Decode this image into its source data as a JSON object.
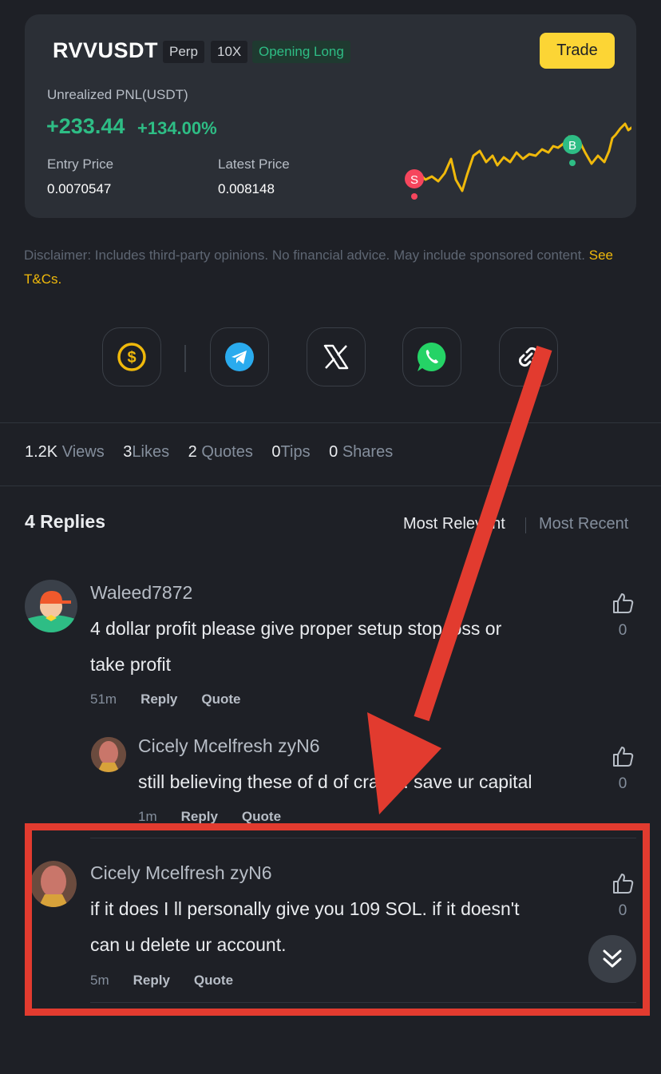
{
  "position": {
    "symbol": "RVVUSDT",
    "tags": [
      "Perp",
      "10X",
      "Opening Long"
    ],
    "trade_label": "Trade",
    "pnl_label": "Unrealized PNL(USDT)",
    "pnl_value": "+233.44",
    "pnl_pct": "+134.00%",
    "entry_label": "Entry Price",
    "entry_value": "0.0070547",
    "latest_label": "Latest Price",
    "latest_value": "0.008148",
    "sell_marker": "S",
    "buy_marker": "B"
  },
  "disclaimer": {
    "text": "Disclaimer: Includes third-party opinions. No financial advice. May include sponsored content.",
    "link": "See T&Cs."
  },
  "share": {
    "icons": [
      "tip-dollar-icon",
      "telegram-icon",
      "x-icon",
      "whatsapp-icon",
      "link-icon"
    ]
  },
  "stats": {
    "views_num": "1.2K",
    "views_label": "Views",
    "likes_num": "3",
    "likes_label": "Likes",
    "quotes_num": "2",
    "quotes_label": "Quotes",
    "tips_num": "0",
    "tips_label": "Tips",
    "shares_num": "0",
    "shares_label": "Shares"
  },
  "replies": {
    "title": "4 Replies",
    "sort_relevant": "Most Relevant",
    "sort_recent": "Most Recent",
    "items": [
      {
        "user": "Waleed7872",
        "line1": "4 dollar profit please give proper setup stop loss or",
        "line2": "take profit",
        "time": "51m",
        "reply": "Reply",
        "quote": "Quote",
        "likes": "0"
      },
      {
        "user": "Cicely Mcelfresh zyN6",
        "line1": "still believing these of d of craps . save ur capital",
        "time": "1m",
        "reply": "Reply",
        "quote": "Quote",
        "likes": "0"
      },
      {
        "user": "Cicely Mcelfresh zyN6",
        "line1": "if it does I ll personally give you 109 SOL. if it doesn't",
        "line2": "can u delete ur account.",
        "time": "5m",
        "reply": "Reply",
        "quote": "Quote",
        "likes": "0"
      }
    ]
  },
  "colors": {
    "background": "#1e2026",
    "card": "#2b2f36",
    "accent": "#fcd535",
    "profit": "#2ebd85",
    "annotation": "#e23b2f"
  }
}
